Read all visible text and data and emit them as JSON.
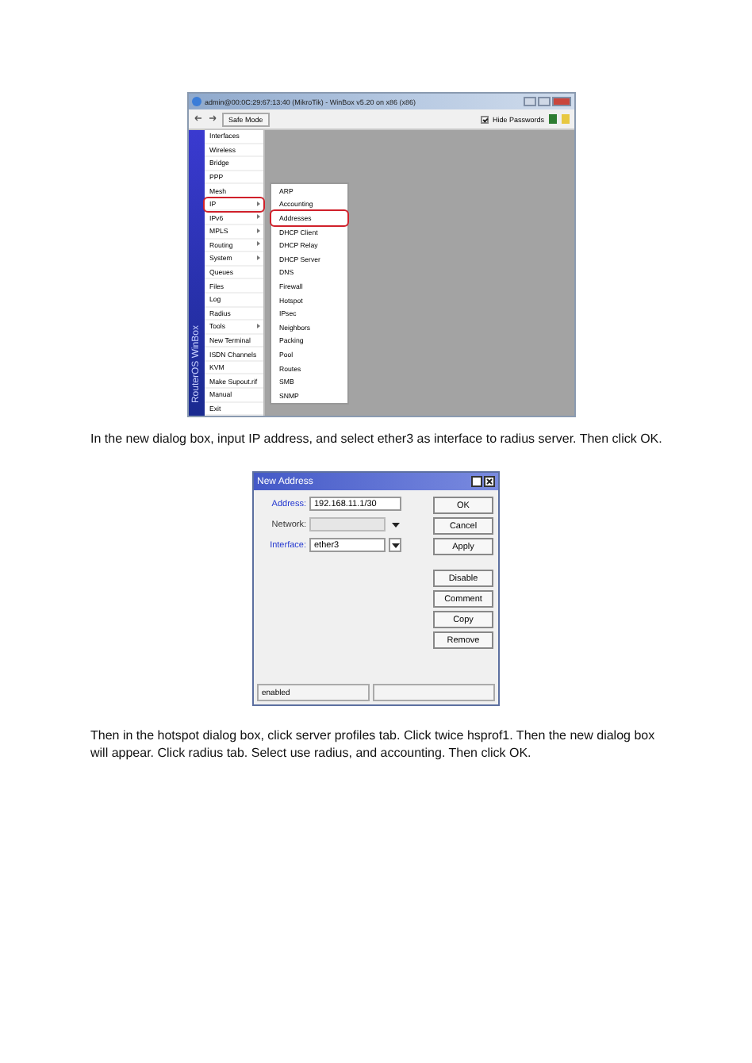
{
  "winbox": {
    "title": "admin@00:0C:29:67:13:40 (MikroTik) - WinBox v5.20 on x86 (x86)",
    "toolbar": {
      "safe_mode": "Safe Mode",
      "hide_passwords": {
        "label": "Hide Passwords",
        "checked": true
      }
    },
    "sidebar_caption": "RouterOS WinBox",
    "menu": [
      {
        "label": "Interfaces",
        "submenu": false,
        "circled": false
      },
      {
        "label": "Wireless",
        "submenu": false,
        "circled": false
      },
      {
        "label": "Bridge",
        "submenu": false,
        "circled": false
      },
      {
        "label": "PPP",
        "submenu": false,
        "circled": false
      },
      {
        "label": "Mesh",
        "submenu": false,
        "circled": false
      },
      {
        "label": "IP",
        "submenu": true,
        "circled": true
      },
      {
        "label": "IPv6",
        "submenu": true,
        "circled": false
      },
      {
        "label": "MPLS",
        "submenu": true,
        "circled": false
      },
      {
        "label": "Routing",
        "submenu": true,
        "circled": false
      },
      {
        "label": "System",
        "submenu": true,
        "circled": false
      },
      {
        "label": "Queues",
        "submenu": false,
        "circled": false
      },
      {
        "label": "Files",
        "submenu": false,
        "circled": false
      },
      {
        "label": "Log",
        "submenu": false,
        "circled": false
      },
      {
        "label": "Radius",
        "submenu": false,
        "circled": false
      },
      {
        "label": "Tools",
        "submenu": true,
        "circled": false
      },
      {
        "label": "New Terminal",
        "submenu": false,
        "circled": false
      },
      {
        "label": "ISDN Channels",
        "submenu": false,
        "circled": false
      },
      {
        "label": "KVM",
        "submenu": false,
        "circled": false
      },
      {
        "label": "Make Supout.rif",
        "submenu": false,
        "circled": false
      },
      {
        "label": "Manual",
        "submenu": false,
        "circled": false
      },
      {
        "label": "Exit",
        "submenu": false,
        "circled": false
      }
    ],
    "submenu": [
      {
        "label": "ARP",
        "circled": false
      },
      {
        "label": "Accounting",
        "circled": false
      },
      {
        "label": "Addresses",
        "circled": true
      },
      {
        "label": "DHCP Client",
        "circled": false
      },
      {
        "label": "DHCP Relay",
        "circled": false
      },
      {
        "label": "DHCP Server",
        "circled": false
      },
      {
        "label": "DNS",
        "circled": false
      },
      {
        "label": "Firewall",
        "circled": false
      },
      {
        "label": "Hotspot",
        "circled": false
      },
      {
        "label": "IPsec",
        "circled": false
      },
      {
        "label": "Neighbors",
        "circled": false
      },
      {
        "label": "Packing",
        "circled": false
      },
      {
        "label": "Pool",
        "circled": false
      },
      {
        "label": "Routes",
        "circled": false
      },
      {
        "label": "SMB",
        "circled": false
      },
      {
        "label": "SNMP",
        "circled": false
      }
    ]
  },
  "paragraph_1": "In the new dialog box, input IP address, and select ether3 as interface to radius server. Then click OK.",
  "dialog": {
    "title": "New Address",
    "fields": [
      {
        "label": "Address:",
        "value": "192.168.11.1/30",
        "kind": "text",
        "emphasized": true,
        "disabled": false
      },
      {
        "label": "Network:",
        "kind": "dropdown",
        "emphasized": false,
        "disabled": true
      },
      {
        "label": "Interface:",
        "value": "ether3",
        "kind": "dropdown",
        "emphasized": true,
        "disabled": false
      }
    ],
    "buttons": [
      "OK",
      "Cancel",
      "Apply"
    ],
    "more_buttons": [
      "Disable",
      "Comment",
      "Copy",
      "Remove"
    ],
    "status": "enabled"
  },
  "paragraph_2": "Then in the hotspot dialog box, click server profiles tab. Click twice hsprof1. Then the new dialog box will appear. Click radius tab. Select use radius, and accounting. Then click OK."
}
